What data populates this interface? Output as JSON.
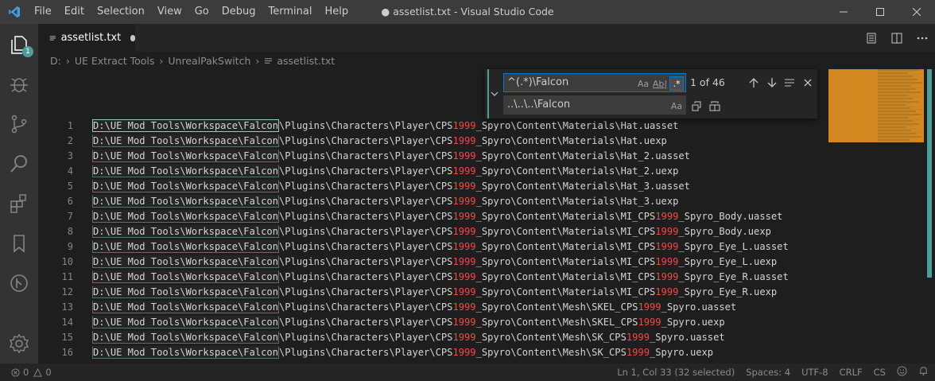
{
  "window": {
    "title": "● assetlist.txt - Visual Studio Code",
    "menu": [
      "File",
      "Edit",
      "Selection",
      "View",
      "Go",
      "Debug",
      "Terminal",
      "Help"
    ]
  },
  "activity": {
    "explorer_badge": "1",
    "icons": [
      "files-icon",
      "debug-icon",
      "source-control-icon",
      "search-icon",
      "extensions-icon",
      "bookmark-icon",
      "git-graph-icon",
      "settings-gear-icon"
    ]
  },
  "tab": {
    "label": "assetlist.txt",
    "dirty": true
  },
  "breadcrumbs": [
    "D:",
    "UE Extract Tools",
    "UnrealPakSwitch",
    "assetlist.txt"
  ],
  "find": {
    "search_value": "^(.*)\\Falcon",
    "replace_value": "..\\..\\..\\Falcon",
    "match_count": "1 of 46",
    "options": {
      "match_case": "Aa",
      "whole_word": "Ab|",
      "regex": ".*",
      "preserve_case": "AB"
    },
    "regex_enabled": true
  },
  "editor": {
    "prefix": "D:\\UE Mod Tools\\Workspace\\Falcon",
    "lines": [
      {
        "n": "1",
        "a": "\\Plugins\\Characters\\Player\\CPS",
        "b": "_Spyro\\Content\\Materials\\Hat.uasset",
        "c": "",
        "d": ""
      },
      {
        "n": "2",
        "a": "\\Plugins\\Characters\\Player\\CPS",
        "b": "_Spyro\\Content\\Materials\\Hat.uexp",
        "c": "",
        "d": ""
      },
      {
        "n": "3",
        "a": "\\Plugins\\Characters\\Player\\CPS",
        "b": "_Spyro\\Content\\Materials\\Hat_2.uasset",
        "c": "",
        "d": ""
      },
      {
        "n": "4",
        "a": "\\Plugins\\Characters\\Player\\CPS",
        "b": "_Spyro\\Content\\Materials\\Hat_2.uexp",
        "c": "",
        "d": ""
      },
      {
        "n": "5",
        "a": "\\Plugins\\Characters\\Player\\CPS",
        "b": "_Spyro\\Content\\Materials\\Hat_3.uasset",
        "c": "",
        "d": ""
      },
      {
        "n": "6",
        "a": "\\Plugins\\Characters\\Player\\CPS",
        "b": "_Spyro\\Content\\Materials\\Hat_3.uexp",
        "c": "",
        "d": ""
      },
      {
        "n": "7",
        "a": "\\Plugins\\Characters\\Player\\CPS",
        "b": "_Spyro\\Content\\Materials\\MI_CPS",
        "c": "1999",
        "d": "_Spyro_Body.uasset"
      },
      {
        "n": "8",
        "a": "\\Plugins\\Characters\\Player\\CPS",
        "b": "_Spyro\\Content\\Materials\\MI_CPS",
        "c": "1999",
        "d": "_Spyro_Body.uexp"
      },
      {
        "n": "9",
        "a": "\\Plugins\\Characters\\Player\\CPS",
        "b": "_Spyro\\Content\\Materials\\MI_CPS",
        "c": "1999",
        "d": "_Spyro_Eye_L.uasset"
      },
      {
        "n": "10",
        "a": "\\Plugins\\Characters\\Player\\CPS",
        "b": "_Spyro\\Content\\Materials\\MI_CPS",
        "c": "1999",
        "d": "_Spyro_Eye_L.uexp"
      },
      {
        "n": "11",
        "a": "\\Plugins\\Characters\\Player\\CPS",
        "b": "_Spyro\\Content\\Materials\\MI_CPS",
        "c": "1999",
        "d": "_Spyro_Eye_R.uasset"
      },
      {
        "n": "12",
        "a": "\\Plugins\\Characters\\Player\\CPS",
        "b": "_Spyro\\Content\\Materials\\MI_CPS",
        "c": "1999",
        "d": "_Spyro_Eye_R.uexp"
      },
      {
        "n": "13",
        "a": "\\Plugins\\Characters\\Player\\CPS",
        "b": "_Spyro\\Content\\Mesh\\SKEL_CPS",
        "c": "1999",
        "d": "_Spyro.uasset"
      },
      {
        "n": "14",
        "a": "\\Plugins\\Characters\\Player\\CPS",
        "b": "_Spyro\\Content\\Mesh\\SKEL_CPS",
        "c": "1999",
        "d": "_Spyro.uexp"
      },
      {
        "n": "15",
        "a": "\\Plugins\\Characters\\Player\\CPS",
        "b": "_Spyro\\Content\\Mesh\\SK_CPS",
        "c": "1999",
        "d": "_Spyro.uasset"
      },
      {
        "n": "16",
        "a": "\\Plugins\\Characters\\Player\\CPS",
        "b": "_Spyro\\Content\\Mesh\\SK_CPS",
        "c": "1999",
        "d": "_Spyro.uexp"
      }
    ],
    "highlight_number": "1999"
  },
  "status": {
    "errors": "0",
    "warnings": "0",
    "cursor": "Ln 1, Col 33 (32 selected)",
    "spaces": "Spaces: 4",
    "encoding": "UTF-8",
    "eol": "CRLF",
    "language": "CS"
  },
  "colors": {
    "accent": "#007acc",
    "teal": "#4d9e99",
    "number_red": "#f44747",
    "minimap": "#d2881e"
  }
}
